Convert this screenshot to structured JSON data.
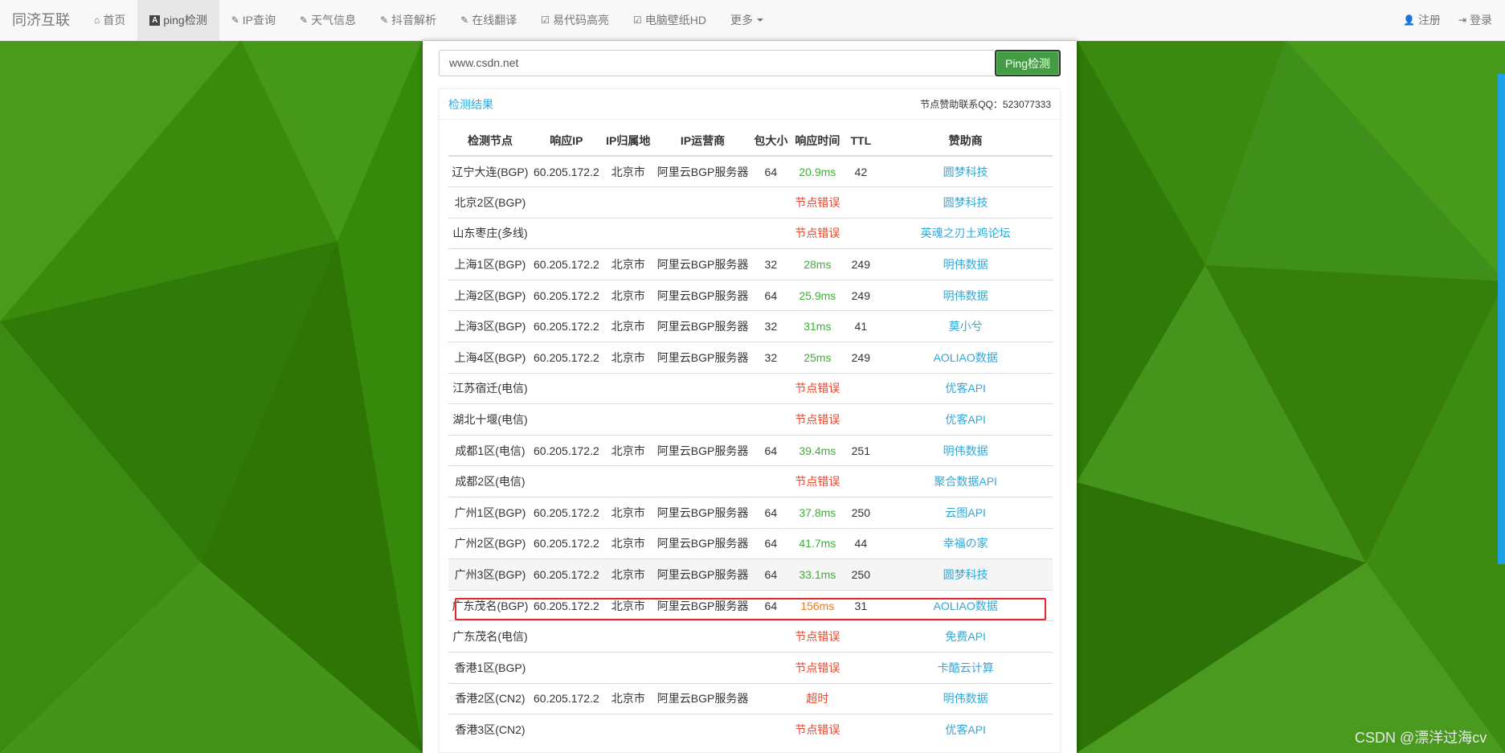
{
  "navbar": {
    "brand": "同济互联",
    "items": [
      {
        "label": "首页",
        "icon": "home-icon",
        "glyph": "⌂"
      },
      {
        "label": "ping检测",
        "icon": "ping-icon",
        "glyph": "A"
      },
      {
        "label": "IP查询",
        "icon": "pencil-icon",
        "glyph": "✎"
      },
      {
        "label": "天气信息",
        "icon": "pencil-icon",
        "glyph": "✎"
      },
      {
        "label": "抖音解析",
        "icon": "pencil-icon",
        "glyph": "✎"
      },
      {
        "label": "在线翻译",
        "icon": "pencil-icon",
        "glyph": "✎"
      },
      {
        "label": "易代码高亮",
        "icon": "edit-icon",
        "glyph": "☑"
      },
      {
        "label": "电脑壁纸HD",
        "icon": "edit-icon",
        "glyph": "☑"
      },
      {
        "label": "更多",
        "icon": "caret-down-icon",
        "glyph": ""
      }
    ],
    "register": "注册",
    "login": "登录"
  },
  "search": {
    "value": "www.csdn.net",
    "button": "Ping检测"
  },
  "card": {
    "title": "检测结果",
    "sponsor_contact": "节点赞助联系QQ：523077333"
  },
  "table": {
    "headers": [
      "检测节点",
      "响应IP",
      "IP归属地",
      "IP运营商",
      "包大小",
      "响应时间",
      "TTL",
      "赞助商"
    ],
    "rows": [
      {
        "node": "辽宁大连(BGP)",
        "ip": "60.205.172.2",
        "loc": "北京市",
        "isp": "阿里云BGP服务器",
        "size": "64",
        "time": "20.9ms",
        "status": "ok",
        "ttl": "42",
        "sponsor": "圆梦科技"
      },
      {
        "node": "北京2区(BGP)",
        "ip": "",
        "loc": "",
        "isp": "",
        "size": "",
        "time": "节点错误",
        "status": "err",
        "ttl": "",
        "sponsor": "圆梦科技"
      },
      {
        "node": "山东枣庄(多线)",
        "ip": "",
        "loc": "",
        "isp": "",
        "size": "",
        "time": "节点错误",
        "status": "err",
        "ttl": "",
        "sponsor": "英魂之刃土鸡论坛"
      },
      {
        "node": "上海1区(BGP)",
        "ip": "60.205.172.2",
        "loc": "北京市",
        "isp": "阿里云BGP服务器",
        "size": "32",
        "time": "28ms",
        "status": "ok",
        "ttl": "249",
        "sponsor": "明伟数据"
      },
      {
        "node": "上海2区(BGP)",
        "ip": "60.205.172.2",
        "loc": "北京市",
        "isp": "阿里云BGP服务器",
        "size": "64",
        "time": "25.9ms",
        "status": "ok",
        "ttl": "249",
        "sponsor": "明伟数据"
      },
      {
        "node": "上海3区(BGP)",
        "ip": "60.205.172.2",
        "loc": "北京市",
        "isp": "阿里云BGP服务器",
        "size": "32",
        "time": "31ms",
        "status": "ok",
        "ttl": "41",
        "sponsor": "莫小兮"
      },
      {
        "node": "上海4区(BGP)",
        "ip": "60.205.172.2",
        "loc": "北京市",
        "isp": "阿里云BGP服务器",
        "size": "32",
        "time": "25ms",
        "status": "ok",
        "ttl": "249",
        "sponsor": "AOLIAO数据"
      },
      {
        "node": "江苏宿迁(电信)",
        "ip": "",
        "loc": "",
        "isp": "",
        "size": "",
        "time": "节点错误",
        "status": "err",
        "ttl": "",
        "sponsor": "优客API"
      },
      {
        "node": "湖北十堰(电信)",
        "ip": "",
        "loc": "",
        "isp": "",
        "size": "",
        "time": "节点错误",
        "status": "err",
        "ttl": "",
        "sponsor": "优客API"
      },
      {
        "node": "成都1区(电信)",
        "ip": "60.205.172.2",
        "loc": "北京市",
        "isp": "阿里云BGP服务器",
        "size": "64",
        "time": "39.4ms",
        "status": "ok",
        "ttl": "251",
        "sponsor": "明伟数据"
      },
      {
        "node": "成都2区(电信)",
        "ip": "",
        "loc": "",
        "isp": "",
        "size": "",
        "time": "节点错误",
        "status": "err",
        "ttl": "",
        "sponsor": "聚合数据API"
      },
      {
        "node": "广州1区(BGP)",
        "ip": "60.205.172.2",
        "loc": "北京市",
        "isp": "阿里云BGP服务器",
        "size": "64",
        "time": "37.8ms",
        "status": "ok",
        "ttl": "250",
        "sponsor": "云图API"
      },
      {
        "node": "广州2区(BGP)",
        "ip": "60.205.172.2",
        "loc": "北京市",
        "isp": "阿里云BGP服务器",
        "size": "64",
        "time": "41.7ms",
        "status": "ok",
        "ttl": "44",
        "sponsor": "幸福の家"
      },
      {
        "node": "广州3区(BGP)",
        "ip": "60.205.172.2",
        "loc": "北京市",
        "isp": "阿里云BGP服务器",
        "size": "64",
        "time": "33.1ms",
        "status": "ok",
        "ttl": "250",
        "sponsor": "圆梦科技",
        "hover": true
      },
      {
        "node": "广东茂名(BGP)",
        "ip": "60.205.172.2",
        "loc": "北京市",
        "isp": "阿里云BGP服务器",
        "size": "64",
        "time": "156ms",
        "status": "warn",
        "ttl": "31",
        "sponsor": "AOLIAO数据"
      },
      {
        "node": "广东茂名(电信)",
        "ip": "",
        "loc": "",
        "isp": "",
        "size": "",
        "time": "节点错误",
        "status": "err",
        "ttl": "",
        "sponsor": "免费API"
      },
      {
        "node": "香港1区(BGP)",
        "ip": "",
        "loc": "",
        "isp": "",
        "size": "",
        "time": "节点错误",
        "status": "err",
        "ttl": "",
        "sponsor": "卡酷云计算"
      },
      {
        "node": "香港2区(CN2)",
        "ip": "60.205.172.2",
        "loc": "北京市",
        "isp": "阿里云BGP服务器",
        "size": "",
        "time": "超时",
        "status": "err",
        "ttl": "",
        "sponsor": "明伟数据"
      },
      {
        "node": "香港3区(CN2)",
        "ip": "",
        "loc": "",
        "isp": "",
        "size": "",
        "time": "节点错误",
        "status": "err",
        "ttl": "",
        "sponsor": "优客API"
      }
    ]
  },
  "watermark": "CSDN @漂洋过海cv",
  "colors": {
    "ok": "#3cb034",
    "error": "#e2492e",
    "slow": "#f07b1e",
    "sponsor_link": "#31a8d8",
    "background": "#3f8f12"
  }
}
